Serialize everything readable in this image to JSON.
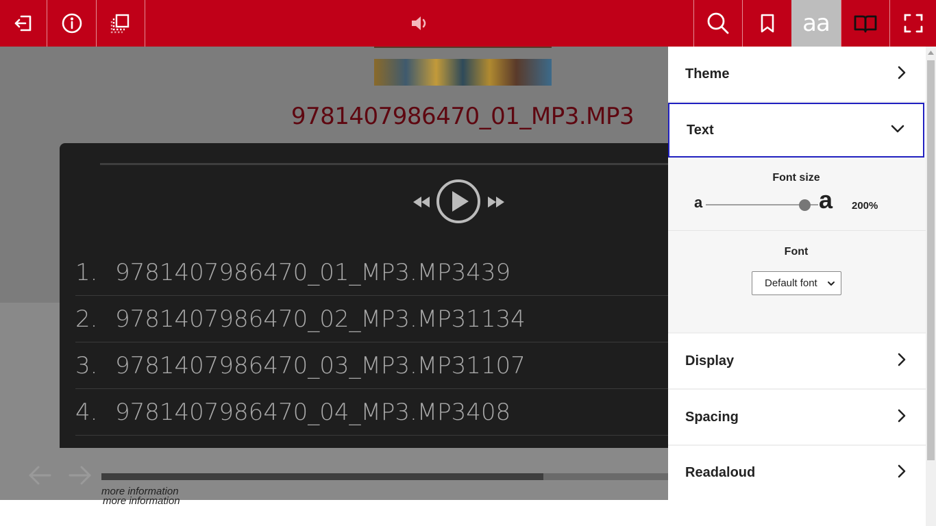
{
  "toolbar": {
    "background": "#c00018",
    "buttons": [
      {
        "name": "exit",
        "icon": "exit-icon"
      },
      {
        "name": "info",
        "icon": "info-icon"
      },
      {
        "name": "pages",
        "icon": "pages-icon"
      },
      {
        "name": "audio",
        "icon": "speaker-icon"
      },
      {
        "name": "search",
        "icon": "search-icon"
      },
      {
        "name": "bookmark",
        "icon": "bookmark-icon"
      },
      {
        "name": "text-settings",
        "icon": "text-size-icon",
        "glyph": "aa",
        "active": true
      },
      {
        "name": "book-view",
        "icon": "open-book-icon"
      },
      {
        "name": "fullscreen",
        "icon": "fullscreen-icon"
      }
    ]
  },
  "content": {
    "track_heading": "9781407986470_01_MP3.MP3",
    "player": {
      "controls": [
        "rewind-icon",
        "play-icon",
        "fast-forward-icon"
      ],
      "tracks": [
        {
          "num": "1.",
          "title": "9781407986470_01_MP3.MP3439"
        },
        {
          "num": "2.",
          "title": "9781407986470_02_MP3.MP31134"
        },
        {
          "num": "3.",
          "title": "9781407986470_03_MP3.MP31107"
        },
        {
          "num": "4.",
          "title": "9781407986470_04_MP3.MP3408"
        }
      ]
    },
    "navigation": {
      "prev_icon": "arrow-left-icon",
      "next_icon": "arrow-right-icon"
    },
    "progress": 0.78,
    "more_info": [
      "more information",
      "more information"
    ]
  },
  "panel": {
    "sections": [
      {
        "title": "Theme",
        "state": "collapsed"
      },
      {
        "title": "Text",
        "state": "expanded"
      },
      {
        "title": "Display",
        "state": "collapsed"
      },
      {
        "title": "Spacing",
        "state": "collapsed"
      },
      {
        "title": "Readaloud",
        "state": "collapsed"
      }
    ],
    "text": {
      "font_size_label": "Font size",
      "small_a": "a",
      "large_a": "a",
      "font_size_value": "200%",
      "font_size_fraction": 0.88,
      "font_label": "Font",
      "font_selected": "Default font"
    },
    "focus_color": "#2020c0"
  }
}
